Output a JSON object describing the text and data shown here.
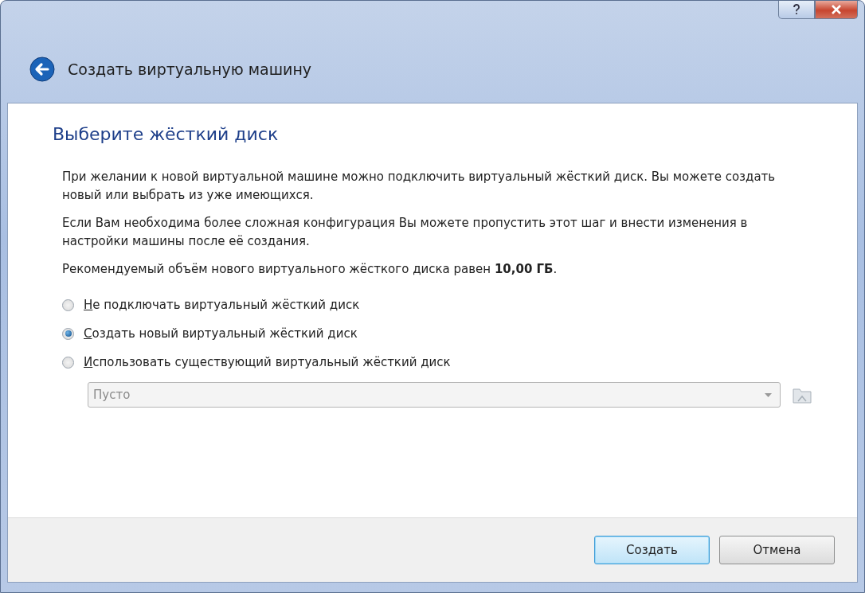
{
  "window": {
    "title": "Создать виртуальную машину"
  },
  "page": {
    "heading": "Выберите жёсткий диск",
    "paragraphs": [
      "При желании к новой виртуальной машине можно подключить виртуальный жёсткий диск. Вы можете создать новый или выбрать из уже имеющихся.",
      "Если Вам необходима более сложная конфигурация Вы можете пропустить этот шаг и внести изменения в настройки машины после её создания.",
      "Рекомендуемый объём нового виртуального жёсткого диска равен **10,00 ГБ**."
    ],
    "options": [
      {
        "label": "Не подключать виртуальный жёсткий диск",
        "selected": false
      },
      {
        "label": "Создать новый виртуальный жёсткий диск",
        "selected": true
      },
      {
        "label": "Использовать существующий виртуальный жёсткий диск",
        "selected": false
      }
    ],
    "disk_select": {
      "value": "Пусто",
      "disabled": true
    }
  },
  "buttons": [
    {
      "label": "Создать",
      "default": true
    },
    {
      "label": "Отмена",
      "default": false
    }
  ]
}
